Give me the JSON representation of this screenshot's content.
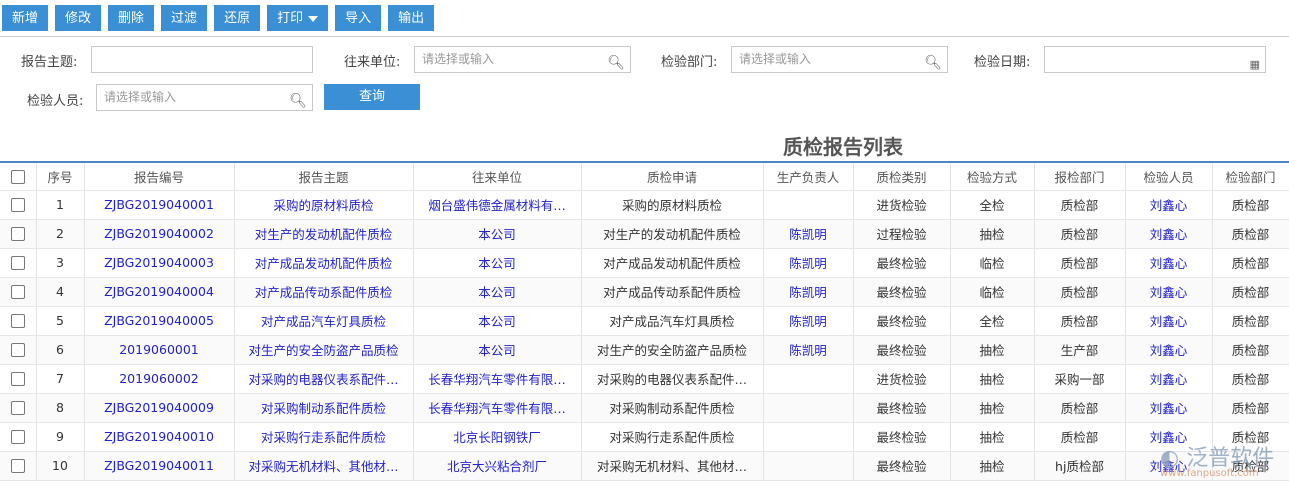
{
  "toolbar": {
    "buttons": [
      "新增",
      "修改",
      "删除",
      "过滤",
      "还原",
      "打印",
      "导入",
      "输出"
    ]
  },
  "filters": {
    "subject_label": "报告主题:",
    "unit_label": "往来单位:",
    "unit_placeholder": "请选择或输入",
    "dept_label": "检验部门:",
    "dept_placeholder": "请选择或输入",
    "date_label": "检验日期:",
    "inspector_label": "检验人员:",
    "inspector_placeholder": "请选择或输入",
    "query_label": "查询"
  },
  "table_title": "质检报告列表",
  "columns": [
    "序号",
    "报告编号",
    "报告主题",
    "往来单位",
    "质检申请",
    "生产负责人",
    "质检类别",
    "检验方式",
    "报检部门",
    "检验人员",
    "检验部门"
  ],
  "rows": [
    [
      "1",
      "ZJBG2019040001",
      "采购的原材料质检",
      "烟台盛伟德金属材料有…",
      "采购的原材料质检",
      "",
      "进货检验",
      "全检",
      "质检部",
      "刘鑫心",
      "质检部"
    ],
    [
      "2",
      "ZJBG2019040002",
      "对生产的发动机配件质检",
      "本公司",
      "对生产的发动机配件质检",
      "陈凯明",
      "过程检验",
      "抽检",
      "质检部",
      "刘鑫心",
      "质检部"
    ],
    [
      "3",
      "ZJBG2019040003",
      "对产成品发动机配件质检",
      "本公司",
      "对产成品发动机配件质检",
      "陈凯明",
      "最终检验",
      "临检",
      "质检部",
      "刘鑫心",
      "质检部"
    ],
    [
      "4",
      "ZJBG2019040004",
      "对产成品传动系配件质检",
      "本公司",
      "对产成品传动系配件质检",
      "陈凯明",
      "最终检验",
      "临检",
      "质检部",
      "刘鑫心",
      "质检部"
    ],
    [
      "5",
      "ZJBG2019040005",
      "对产成品汽车灯具质检",
      "本公司",
      "对产成品汽车灯具质检",
      "陈凯明",
      "最终检验",
      "全检",
      "质检部",
      "刘鑫心",
      "质检部"
    ],
    [
      "6",
      "2019060001",
      "对生产的安全防盗产品质检",
      "本公司",
      "对生产的安全防盗产品质检",
      "陈凯明",
      "最终检验",
      "抽检",
      "生产部",
      "刘鑫心",
      "质检部"
    ],
    [
      "7",
      "2019060002",
      "对采购的电器仪表系配件…",
      "长春华翔汽车零件有限…",
      "对采购的电器仪表系配件…",
      "",
      "进货检验",
      "抽检",
      "采购一部",
      "刘鑫心",
      "质检部"
    ],
    [
      "8",
      "ZJBG2019040009",
      "对采购制动系配件质检",
      "长春华翔汽车零件有限…",
      "对采购制动系配件质检",
      "",
      "最终检验",
      "抽检",
      "质检部",
      "刘鑫心",
      "质检部"
    ],
    [
      "9",
      "ZJBG2019040010",
      "对采购行走系配件质检",
      "北京长阳钢铁厂",
      "对采购行走系配件质检",
      "",
      "最终检验",
      "抽检",
      "质检部",
      "刘鑫心",
      "质检部"
    ],
    [
      "10",
      "ZJBG2019040011",
      "对采购无机材料、其他材…",
      "北京大兴粘合剂厂",
      "对采购无机材料、其他材…",
      "",
      "最终检验",
      "抽检",
      "hj质检部",
      "刘鑫心",
      "质检部"
    ]
  ],
  "watermark": {
    "text": "泛普软件",
    "url": "www.fanpusoft.com"
  }
}
